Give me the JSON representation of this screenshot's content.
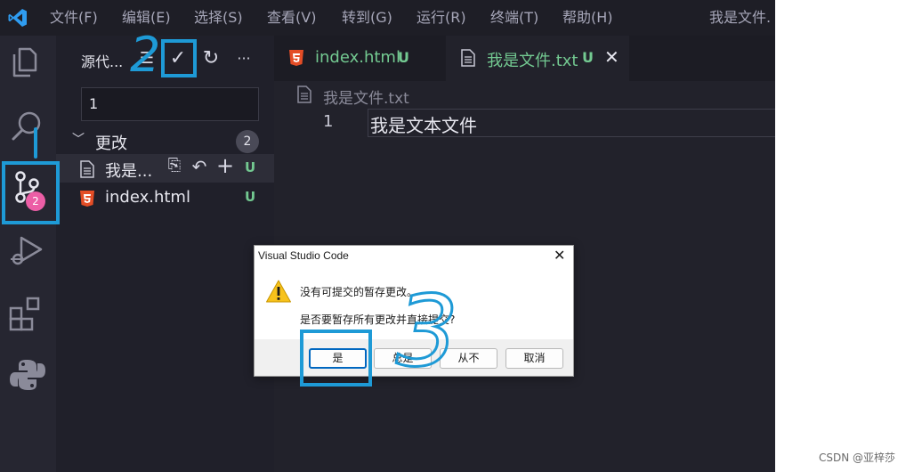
{
  "titlebar": {
    "menus": [
      "文件(F)",
      "编辑(E)",
      "选择(S)",
      "查看(V)",
      "转到(G)",
      "运行(R)",
      "终端(T)",
      "帮助(H)"
    ],
    "title": "我是文件."
  },
  "activity": {
    "items": [
      "explorer-icon",
      "search-icon",
      "source-control-icon",
      "run-debug-icon",
      "extensions-icon",
      "python-icon"
    ],
    "scm_badge": "2",
    "accent_color": "#0078d4",
    "badge_color": "#ec5ea6"
  },
  "sidebar": {
    "title": "源代...",
    "actions": {
      "view_tree": "☰",
      "commit": "✓",
      "refresh": "↻",
      "more": "···"
    },
    "commit_message": "1",
    "changes": {
      "label": "更改",
      "count": "2",
      "files": [
        {
          "name": "我是...",
          "status": "U",
          "icon": "text-file-icon"
        },
        {
          "name": "index.html",
          "status": "U",
          "icon": "html5-icon"
        }
      ],
      "row_actions": {
        "open": "⎘",
        "discard": "↶",
        "stage": "+"
      }
    }
  },
  "tabs": [
    {
      "label": "index.html",
      "status": "U",
      "icon": "html5-icon",
      "active": false
    },
    {
      "label": "我是文件.txt",
      "status": "U",
      "icon": "text-file-icon",
      "active": true,
      "close": "✕"
    }
  ],
  "editor": {
    "breadcrumb": "我是文件.txt",
    "line_number": "1",
    "line_text": "我是文本文件"
  },
  "dialog": {
    "title": "Visual Studio Code",
    "close": "✕",
    "message": "没有可提交的暂存更改。",
    "question": "是否要暂存所有更改并直接提交?",
    "buttons": {
      "yes": "是",
      "always": "总是",
      "never": "从不",
      "cancel": "取消"
    }
  },
  "annotations": {
    "step2": "2",
    "step3": "3",
    "color": "#1e9ad6"
  },
  "colors": {
    "untracked": "#73c991",
    "html5": "#e44d26",
    "dialog_default": "#0067c0"
  },
  "watermark": "CSDN @亚梓莎"
}
